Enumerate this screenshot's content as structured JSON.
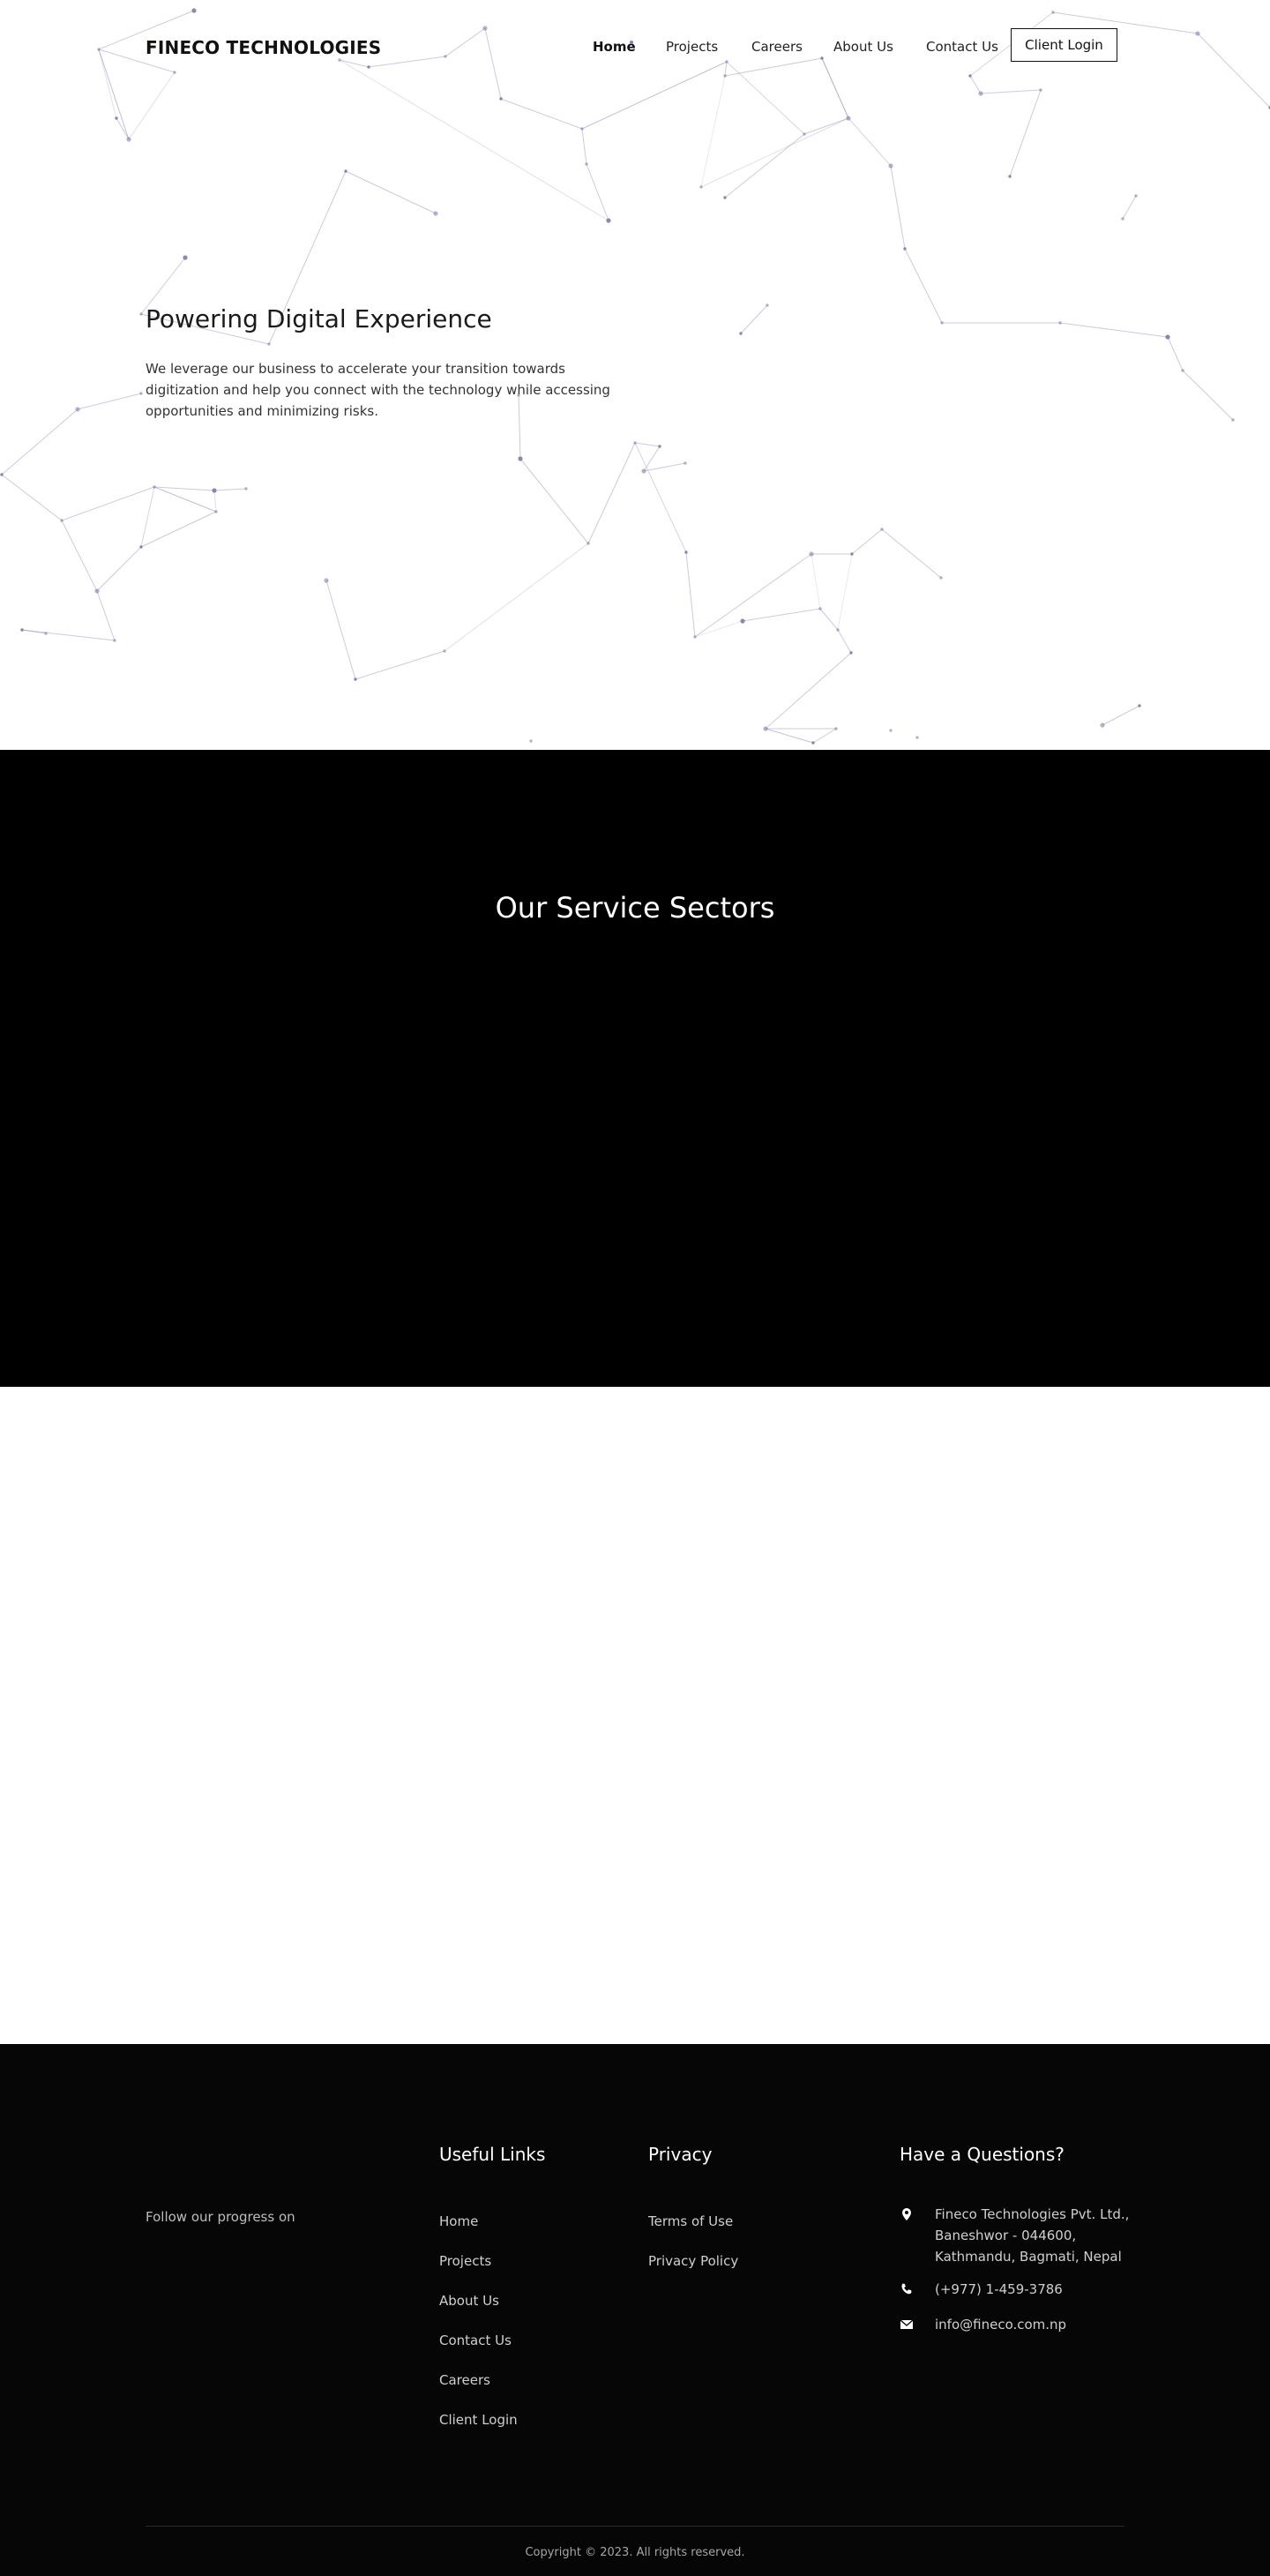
{
  "header": {
    "brand": "FINECO TECHNOLOGIES",
    "nav": [
      {
        "label": "Home",
        "active": true
      },
      {
        "label": "Projects"
      },
      {
        "label": "Careers"
      },
      {
        "label": "About Us"
      },
      {
        "label": "Contact Us"
      }
    ],
    "client_login": "Client Login"
  },
  "hero": {
    "title": "Powering Digital Experience",
    "body": "We leverage our business to accelerate your transition towards digitization and help you connect with the technology while accessing opportunities and minimizing risks."
  },
  "services": {
    "title": "Our Service Sectors"
  },
  "footer": {
    "follow": "Follow our progress on",
    "useful_links": {
      "heading": "Useful Links",
      "items": [
        "Home",
        "Projects",
        "About Us",
        "Contact Us",
        "Careers",
        "Client Login"
      ]
    },
    "privacy": {
      "heading": "Privacy",
      "items": [
        "Terms of Use",
        "Privacy Policy"
      ]
    },
    "contact": {
      "heading": "Have a Questions?",
      "address_line1": "Fineco Technologies Pvt. Ltd.,",
      "address_line2": "Baneshwor - 044600,",
      "address_line3": "Kathmandu, Bagmati, Nepal",
      "phone": "(+977) 1-459-3786",
      "email": "info@fineco.com.np",
      "icons": [
        "map-marker-icon",
        "phone-icon",
        "envelope-icon"
      ]
    },
    "copyright": "Copyright © 2023. All rights reserved."
  },
  "colors": {
    "accent": "#8a7fb0",
    "dark": "#000000"
  }
}
